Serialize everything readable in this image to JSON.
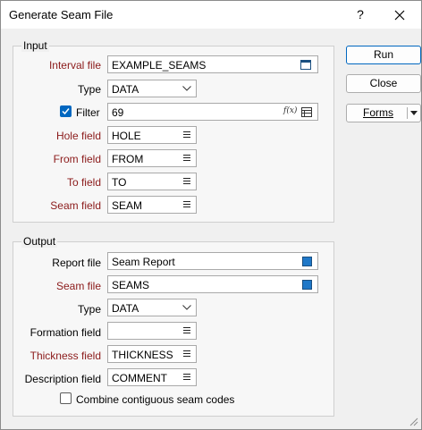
{
  "window": {
    "title": "Generate Seam File",
    "help_glyph": "?"
  },
  "input": {
    "group_label": "Input",
    "interval_file": {
      "label": "Interval file",
      "value": "EXAMPLE_SEAMS"
    },
    "type": {
      "label": "Type",
      "value": "DATA"
    },
    "filter": {
      "label": "Filter",
      "value": "69",
      "checked": true,
      "fx_glyph": "f(x)"
    },
    "hole_field": {
      "label": "Hole field",
      "value": "HOLE"
    },
    "from_field": {
      "label": "From field",
      "value": "FROM"
    },
    "to_field": {
      "label": "To field",
      "value": "TO"
    },
    "seam_field": {
      "label": "Seam field",
      "value": "SEAM"
    }
  },
  "output": {
    "group_label": "Output",
    "report_file": {
      "label": "Report file",
      "value": "Seam Report"
    },
    "seam_file": {
      "label": "Seam file",
      "value": "SEAMS"
    },
    "type": {
      "label": "Type",
      "value": "DATA"
    },
    "formation_field": {
      "label": "Formation field",
      "value": ""
    },
    "thickness_field": {
      "label": "Thickness field",
      "value": "THICKNESS"
    },
    "description_field": {
      "label": "Description field",
      "value": "COMMENT"
    },
    "combine": {
      "label": "Combine contiguous seam codes",
      "checked": false
    }
  },
  "buttons": {
    "run": "Run",
    "close": "Close",
    "forms": "Forms"
  },
  "colors": {
    "required_label": "#8b1a1a",
    "accent": "#0067c0",
    "file_swatch": "#1f78c8"
  }
}
